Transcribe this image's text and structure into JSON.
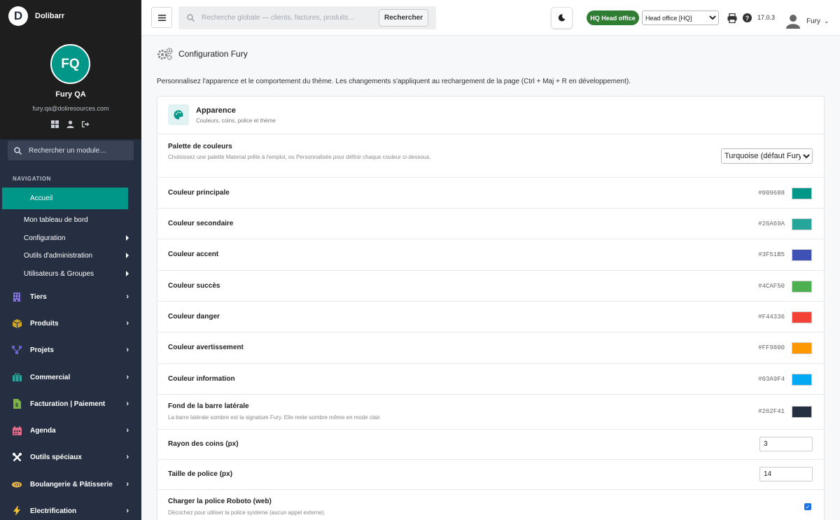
{
  "brand": {
    "logo_letter": "D",
    "name": "Dolibarr"
  },
  "user": {
    "initials": "FQ",
    "name": "Fury QA",
    "email": "fury.qa@doliresources.com"
  },
  "sidebar": {
    "search_placeholder": "Rechercher un module…",
    "nav_title": "NAVIGATION",
    "home": "Accueil",
    "subitems": [
      {
        "label": "Mon tableau de bord"
      },
      {
        "label": "Configuration"
      },
      {
        "label": "Outils d'administration"
      },
      {
        "label": "Utilisateurs & Groupes"
      }
    ],
    "items": [
      {
        "label": "Tiers",
        "icon": "building-icon",
        "color": "#7e6fd6"
      },
      {
        "label": "Produits",
        "icon": "box-icon",
        "color": "#c9a227"
      },
      {
        "label": "Projets",
        "icon": "project-icon",
        "color": "#6c63c9"
      },
      {
        "label": "Commercial",
        "icon": "briefcase-icon",
        "color": "#26a69a"
      },
      {
        "label": "Facturation | Paiement",
        "icon": "invoice-icon",
        "color": "#7cb342"
      },
      {
        "label": "Agenda",
        "icon": "calendar-icon",
        "color": "#e06c8a"
      },
      {
        "label": "Outils spéciaux",
        "icon": "tools-icon",
        "color": "#ffffff"
      },
      {
        "label": "Boulangerie & Pâtisserie",
        "icon": "bread-icon",
        "color": "#e8b84a"
      },
      {
        "label": "Electrification",
        "icon": "lightning-icon",
        "color": "#f5c12e"
      }
    ]
  },
  "topbar": {
    "search_placeholder": "Recherche globale — clients, factures, produits...",
    "search_button": "Rechercher",
    "entity_badge": "HQ Head office",
    "entity_select": "Head office [HQ]",
    "version": "17.0.3",
    "user": "Fury"
  },
  "page": {
    "title": "Configuration Fury",
    "intro": "Personnalisez l'apparence et le comportement du thème. Les changements s'appliquent au rechargement de la page (Ctrl + Maj + R en développement)."
  },
  "card": {
    "title": "Apparence",
    "subtitle": "Couleurs, coins, police et thème",
    "palette": {
      "label": "Palette de couleurs",
      "desc": "Choisissez une palette Material prête à l'emploi, ou Personnalisée pour définir chaque couleur ci-dessous.",
      "value": "Turquoise (défaut Fury)"
    },
    "colors": [
      {
        "label": "Couleur principale",
        "hex": "#009688"
      },
      {
        "label": "Couleur secondaire",
        "hex": "#26A69A"
      },
      {
        "label": "Couleur accent",
        "hex": "#3F51B5"
      },
      {
        "label": "Couleur succès",
        "hex": "#4CAF50"
      },
      {
        "label": "Couleur danger",
        "hex": "#F44336"
      },
      {
        "label": "Couleur avertissement",
        "hex": "#FF9800"
      },
      {
        "label": "Couleur information",
        "hex": "#03A9F4"
      }
    ],
    "sidebar_bg": {
      "label": "Fond de la barre latérale",
      "desc": "La barre latérale sombre est la signature Fury. Elle reste sombre même en mode clair.",
      "hex": "#262F41"
    },
    "radius": {
      "label": "Rayon des coins (px)",
      "value": "3"
    },
    "font_size": {
      "label": "Taille de police (px)",
      "value": "14"
    },
    "roboto": {
      "label": "Charger la police Roboto (web)",
      "desc": "Décochez pour utiliser la police système (aucun appel externe).",
      "checked": true
    }
  }
}
